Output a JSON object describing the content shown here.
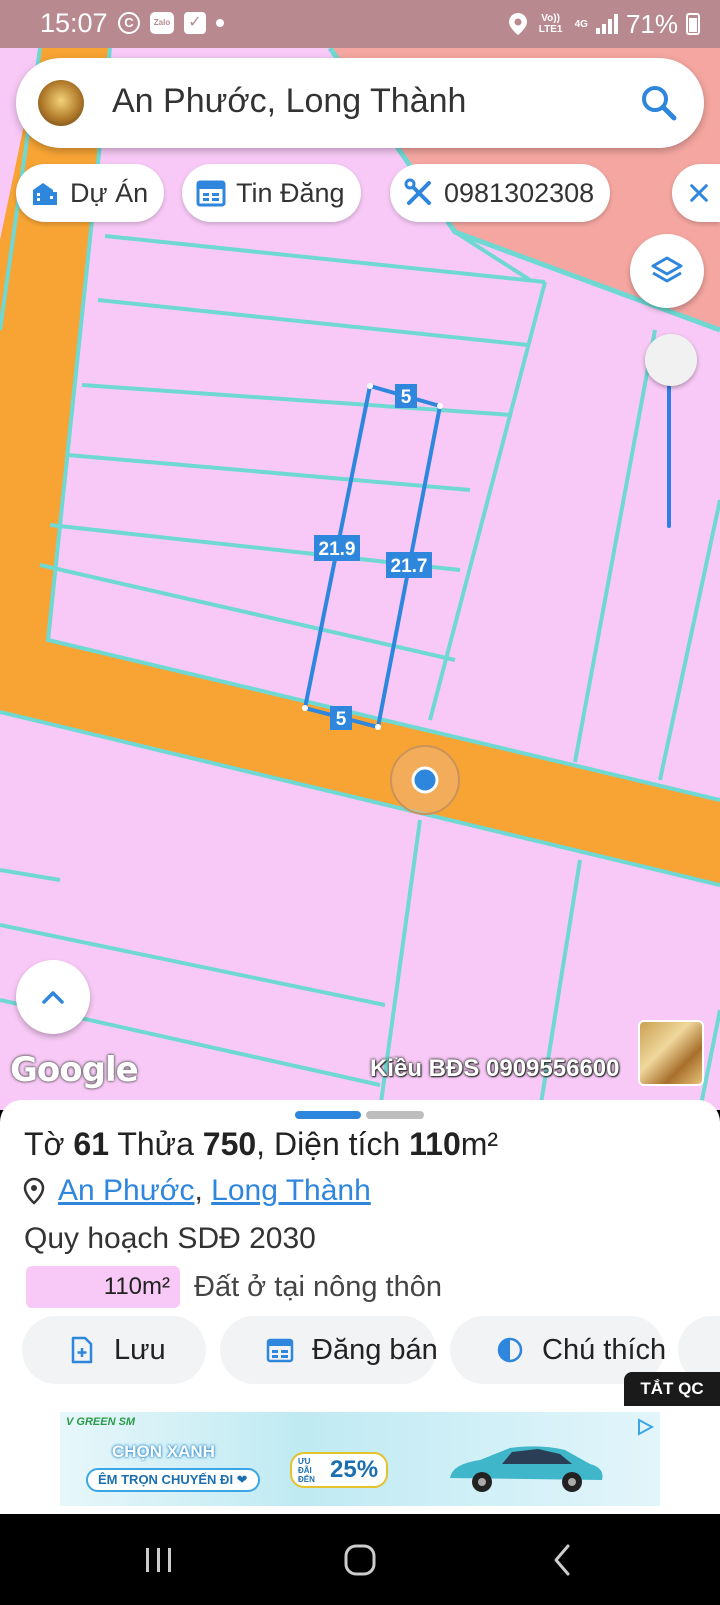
{
  "status_bar": {
    "time": "15:07",
    "network_top": "Vo)) LTE1",
    "network_4g": "4G",
    "battery": "71%"
  },
  "search": {
    "title": "An Phước, Long Thành"
  },
  "chips": [
    {
      "label": "Dự Án",
      "icon": "building-icon"
    },
    {
      "label": "Tin Đăng",
      "icon": "calendar-icon"
    },
    {
      "label": "0981302308",
      "icon": "tools-icon"
    }
  ],
  "map": {
    "lot_labels": {
      "top": "5",
      "left": "21.9",
      "right": "21.7",
      "bottom": "5"
    },
    "watermark": "Kiều BĐS 0909556600",
    "logo": "Google"
  },
  "info": {
    "parcel": {
      "sheet_label": "Tờ",
      "sheet_number": "61",
      "lot_label": "Thửa",
      "lot_number": "750",
      "area_label": ", Diện tích",
      "area_value": "110",
      "area_unit": "m²"
    },
    "location": {
      "ward": "An Phước",
      "separator": ",",
      "district": "Long Thành"
    },
    "plan_title": "Quy hoạch SDĐ 2030",
    "legend": {
      "area": "110m²",
      "label": "Đất ở tại nông thôn",
      "color": "#f8c9f6"
    },
    "actions": [
      {
        "label": "Lưu",
        "icon": "save-file-icon"
      },
      {
        "label": "Đăng bán",
        "icon": "calendar-post-icon"
      },
      {
        "label": "Chú thích",
        "icon": "half-circle-icon"
      }
    ]
  },
  "ad": {
    "close_label": "TẮT QC",
    "brand": "V GREEN SM",
    "headline": "CHỌN XANH",
    "subline": "ÊM TRỌN CHUYẾN ĐI ❤",
    "offer_small": "ƯU ĐÃI ĐẾN",
    "offer_value": "25%"
  },
  "colors": {
    "residential": "#f8c9f6",
    "road": "#f7a434",
    "boundary": "#6fd8d2",
    "selected_lot": "#2f86dd",
    "accent": "#2f86dd"
  }
}
